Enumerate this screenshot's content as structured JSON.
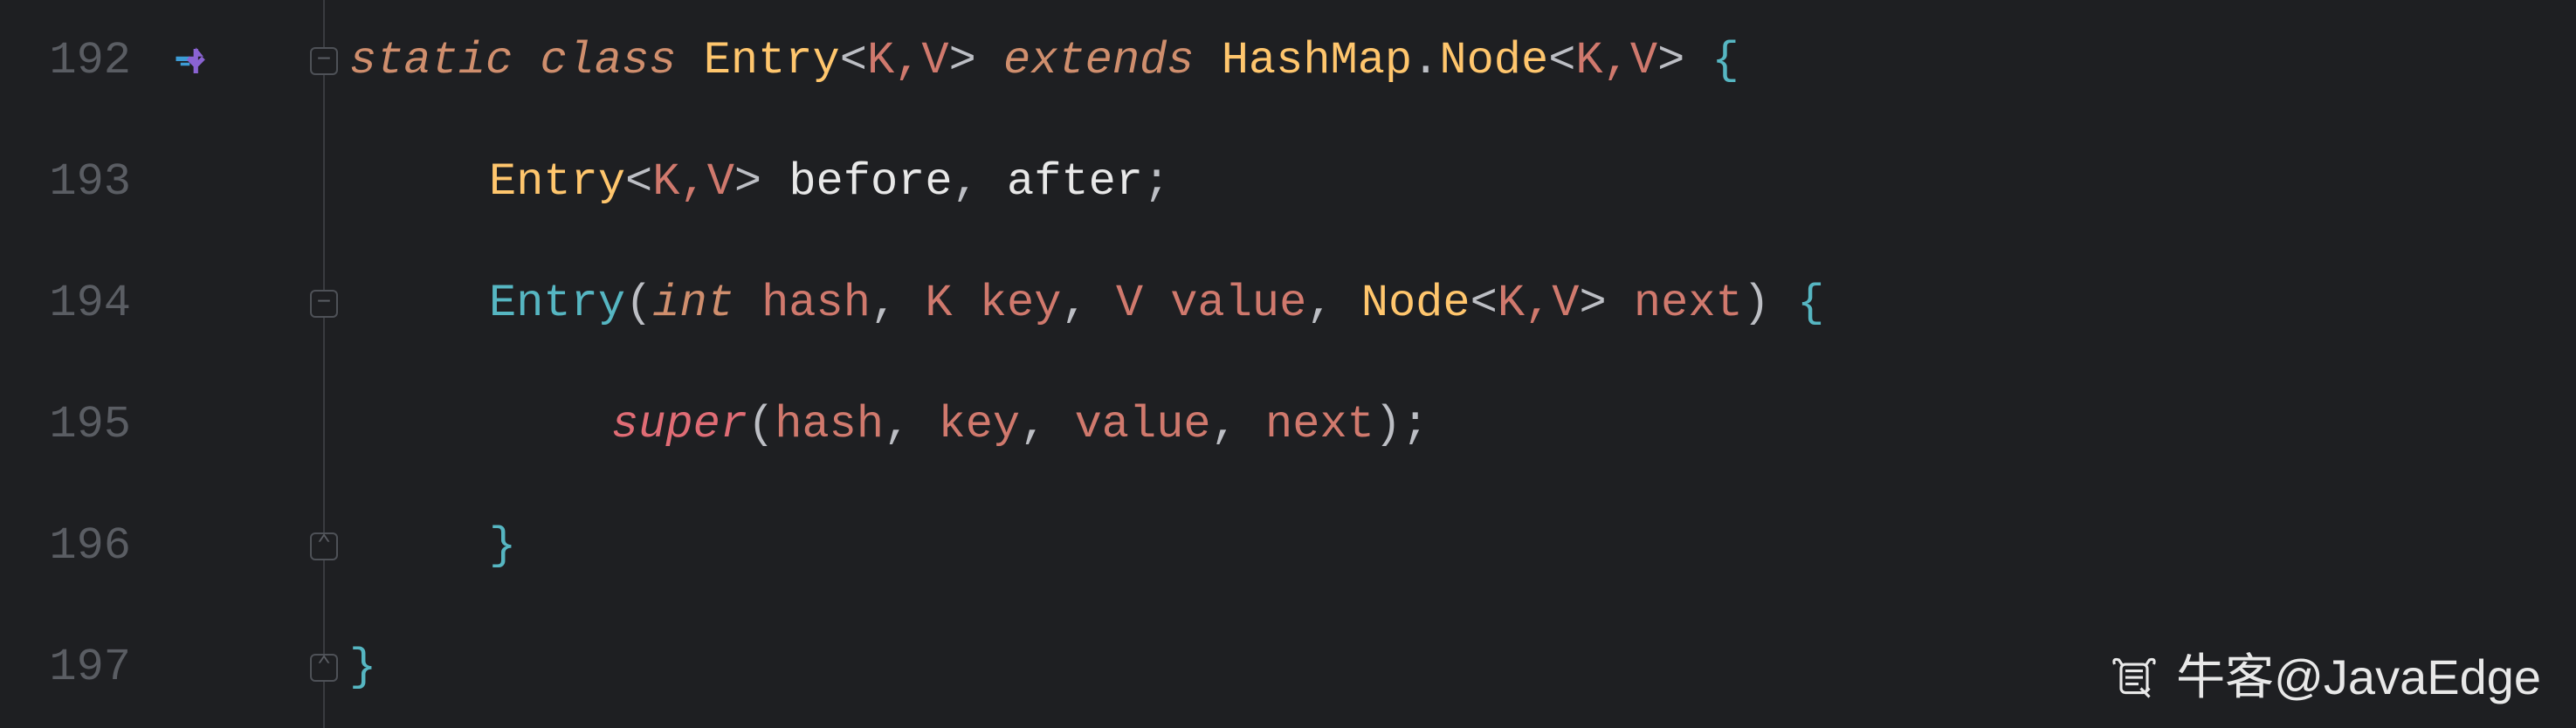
{
  "lines": {
    "l192": {
      "num": "192"
    },
    "l193": {
      "num": "193"
    },
    "l194": {
      "num": "194"
    },
    "l195": {
      "num": "195"
    },
    "l196": {
      "num": "196"
    },
    "l197": {
      "num": "197"
    }
  },
  "code": {
    "static": "static",
    "class": "class",
    "entry": "Entry",
    "lt": "<",
    "k": "K",
    "comma": ",",
    "v": "V",
    "gt": ">",
    "extends": "extends",
    "hashmap": "HashMap",
    "dot": ".",
    "node": "Node",
    "lbrace": "{",
    "rbrace": "}",
    "before": "before",
    "after": "after",
    "semi": ";",
    "int": "int",
    "hash": "hash",
    "key": "key",
    "value": "value",
    "next": "next",
    "lparen": "(",
    "rparen": ")",
    "super": "super",
    "sp": " "
  },
  "watermark": {
    "text": "牛客@JavaEdge"
  }
}
